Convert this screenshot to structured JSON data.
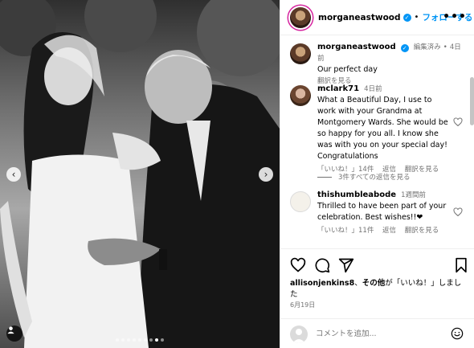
{
  "header": {
    "username": "morganeastwood",
    "separator": "•",
    "follow_label": "フォローする",
    "more_label": "•••"
  },
  "caption": {
    "username": "morganeastwood",
    "edited": "編集済み",
    "separator": "•",
    "time": "4日前",
    "text": "Our perfect day",
    "translate": "翻訳を見る"
  },
  "comments": [
    {
      "username": "mclark71",
      "time": "4日前",
      "text": "What a Beautiful Day, I use to work with your Grandma at Montgomery Wards. She would be so happy for you all. I know she was with you on your special day! Congratulations",
      "likes": "「いいね！」14件",
      "reply": "返信",
      "translate": "翻訳を見る",
      "view_replies": "3件すべての返信を見る"
    },
    {
      "username": "thishumbleabode",
      "time": "1週間前",
      "text": "Thrilled to have been part of your celebration. Best wishes!!❤",
      "likes": "「いいね！」11件",
      "reply": "返信",
      "translate": "翻訳を見る"
    }
  ],
  "likes": {
    "user": "allisonjenkins8",
    "connector": "、",
    "others": "その他",
    "suffix": "が「いいね！」しました"
  },
  "date": "6月19日",
  "add_comment": {
    "placeholder": "コメントを追加..."
  },
  "carousel": {
    "dot_count": 9,
    "active_index": 7
  }
}
